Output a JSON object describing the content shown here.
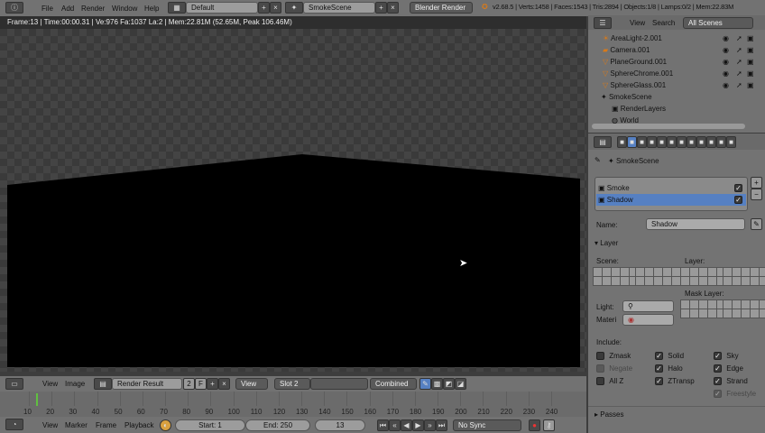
{
  "topbar": {
    "menus": [
      "File",
      "Add",
      "Render",
      "Window",
      "Help"
    ],
    "screen_layout": "Default",
    "scene": "SmokeScene",
    "engine": "Blender Render",
    "stats": "v2.68.5 | Verts:1458 | Faces:1543 | Tris:2894 | Objects:1/8 | Lamps:0/2 | Mem:22.83M"
  },
  "render_info": "Frame:13 | Time:00:00.31 | Ve:976 Fa:1037 La:2 | Mem:22.81M (52.65M, Peak 106.46M)",
  "outliner": {
    "menus": [
      "View",
      "Search"
    ],
    "filter": "All Scenes",
    "items": [
      {
        "name": "AreaLight-2.001",
        "icon": "lamp-icon"
      },
      {
        "name": "Camera.001",
        "icon": "camera-icon"
      },
      {
        "name": "PlaneGround.001",
        "icon": "mesh-icon"
      },
      {
        "name": "SphereChrome.001",
        "icon": "mesh-icon"
      },
      {
        "name": "SphereGlass.001",
        "icon": "mesh-icon"
      }
    ],
    "scene": "SmokeScene",
    "render_layers": "RenderLayers",
    "world": "World"
  },
  "properties": {
    "context": "SmokeScene",
    "layers": [
      {
        "name": "Smoke",
        "enabled": true
      },
      {
        "name": "Shadow",
        "enabled": true,
        "selected": true
      }
    ],
    "name_label": "Name:",
    "name_value": "Shadow",
    "layer_section": "Layer",
    "scene_label": "Scene:",
    "layer_label": "Layer:",
    "mask_layer_label": "Mask Layer:",
    "light_label": "Light:",
    "material_label": "Materi",
    "include_label": "Include:",
    "include": [
      {
        "label": "Zmask",
        "checked": false
      },
      {
        "label": "Solid",
        "checked": true
      },
      {
        "label": "Sky",
        "checked": true
      },
      {
        "label": "Negate",
        "checked": false,
        "disabled": true
      },
      {
        "label": "Halo",
        "checked": true
      },
      {
        "label": "Edge",
        "checked": true
      },
      {
        "label": "All Z",
        "checked": false
      },
      {
        "label": "ZTransp",
        "checked": true
      },
      {
        "label": "Strand",
        "checked": true
      },
      {
        "label": "Freestyle",
        "checked": true,
        "disabled": true
      }
    ],
    "passes_section": "Passes"
  },
  "image_editor": {
    "menus": [
      "View",
      "Image"
    ],
    "image": "Render Result",
    "users": "2",
    "fake": "F",
    "view": "View",
    "slot": "Slot 2",
    "pass": "Combined"
  },
  "timeline": {
    "ticks": [
      10,
      20,
      30,
      40,
      50,
      60,
      70,
      80,
      90,
      100,
      110,
      120,
      130,
      140,
      150,
      160,
      170,
      180,
      190,
      200,
      210,
      220,
      230,
      240
    ],
    "current_frame": 13,
    "menus": [
      "View",
      "Marker",
      "Frame",
      "Playback"
    ],
    "start": "Start: 1",
    "end": "End: 250",
    "frame": "13",
    "sync": "No Sync"
  },
  "colors": {
    "accent": "#5680c2",
    "current_frame": "#60c040"
  }
}
